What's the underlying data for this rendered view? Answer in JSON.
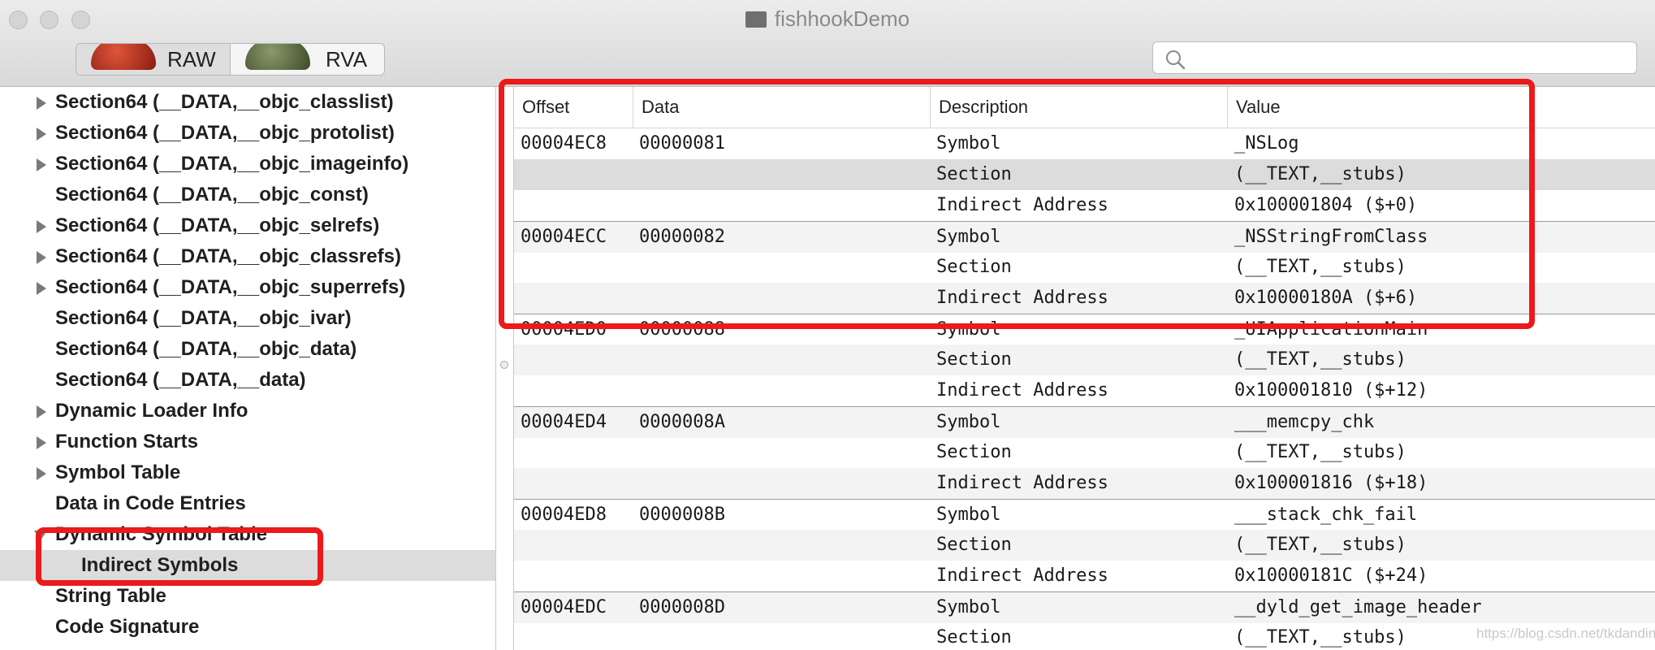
{
  "window": {
    "title": "fishhookDemo"
  },
  "toolbar": {
    "raw_label": "RAW",
    "rva_label": "RVA",
    "search_value": ""
  },
  "sidebar": {
    "items": [
      {
        "label": "Section64 (__DATA,__objc_classlist)",
        "arrow": "right"
      },
      {
        "label": "Section64 (__DATA,__objc_protolist)",
        "arrow": "right"
      },
      {
        "label": "Section64 (__DATA,__objc_imageinfo)",
        "arrow": "right"
      },
      {
        "label": "Section64 (__DATA,__objc_const)",
        "arrow": "none"
      },
      {
        "label": "Section64 (__DATA,__objc_selrefs)",
        "arrow": "right"
      },
      {
        "label": "Section64 (__DATA,__objc_classrefs)",
        "arrow": "right"
      },
      {
        "label": "Section64 (__DATA,__objc_superrefs)",
        "arrow": "right"
      },
      {
        "label": "Section64 (__DATA,__objc_ivar)",
        "arrow": "none"
      },
      {
        "label": "Section64 (__DATA,__objc_data)",
        "arrow": "none"
      },
      {
        "label": "Section64 (__DATA,__data)",
        "arrow": "none"
      },
      {
        "label": "Dynamic Loader Info",
        "arrow": "right"
      },
      {
        "label": "Function Starts",
        "arrow": "right"
      },
      {
        "label": "Symbol Table",
        "arrow": "right"
      },
      {
        "label": "Data in Code Entries",
        "arrow": "none"
      },
      {
        "label": "Dynamic Symbol Table",
        "arrow": "down"
      },
      {
        "label": "Indirect Symbols",
        "arrow": "none",
        "selected": true,
        "child": true
      },
      {
        "label": "String Table",
        "arrow": "none"
      },
      {
        "label": "Code Signature",
        "arrow": "none"
      }
    ]
  },
  "table": {
    "headers": [
      "Offset",
      "Data",
      "Description",
      "Value"
    ],
    "rows": [
      {
        "offset": "00004EC8",
        "data": "00000081",
        "description": "Symbol",
        "value": "_NSLog"
      },
      {
        "offset": "",
        "data": "",
        "description": "Section",
        "value": "(__TEXT,__stubs)"
      },
      {
        "offset": "",
        "data": "",
        "description": "Indirect Address",
        "value": "0x100001804 ($+0)"
      },
      {
        "offset": "00004ECC",
        "data": "00000082",
        "description": "Symbol",
        "value": "_NSStringFromClass"
      },
      {
        "offset": "",
        "data": "",
        "description": "Section",
        "value": "(__TEXT,__stubs)"
      },
      {
        "offset": "",
        "data": "",
        "description": "Indirect Address",
        "value": "0x10000180A ($+6)"
      },
      {
        "offset": "00004ED0",
        "data": "00000088",
        "description": "Symbol",
        "value": "_UIApplicationMain"
      },
      {
        "offset": "",
        "data": "",
        "description": "Section",
        "value": "(__TEXT,__stubs)"
      },
      {
        "offset": "",
        "data": "",
        "description": "Indirect Address",
        "value": "0x100001810 ($+12)"
      },
      {
        "offset": "00004ED4",
        "data": "0000008A",
        "description": "Symbol",
        "value": "___memcpy_chk"
      },
      {
        "offset": "",
        "data": "",
        "description": "Section",
        "value": "(__TEXT,__stubs)"
      },
      {
        "offset": "",
        "data": "",
        "description": "Indirect Address",
        "value": "0x100001816 ($+18)"
      },
      {
        "offset": "00004ED8",
        "data": "0000008B",
        "description": "Symbol",
        "value": "___stack_chk_fail"
      },
      {
        "offset": "",
        "data": "",
        "description": "Section",
        "value": "(__TEXT,__stubs)"
      },
      {
        "offset": "",
        "data": "",
        "description": "Indirect Address",
        "value": "0x10000181C ($+24)"
      },
      {
        "offset": "00004EDC",
        "data": "0000008D",
        "description": "Symbol",
        "value": "__dyld_get_image_header"
      },
      {
        "offset": "",
        "data": "",
        "description": "Section",
        "value": "(__TEXT,__stubs)"
      }
    ]
  },
  "watermark": "https://blog.csdn.net/tkdanding",
  "colors": {
    "highlight_box": "#ec1a1a",
    "selected_row": "#dcdcdc"
  }
}
